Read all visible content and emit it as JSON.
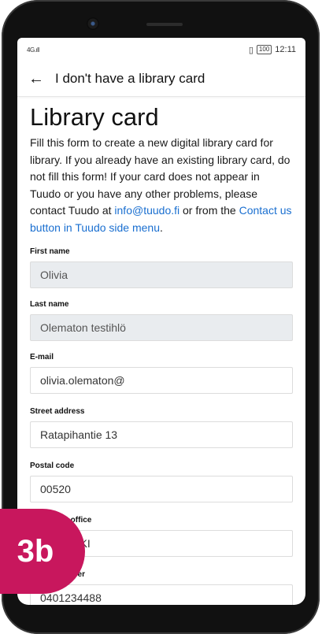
{
  "status": {
    "signal": "4G",
    "time": "12:11",
    "battery": "100"
  },
  "appbar": {
    "title": "I don't have a library card",
    "back_icon": "arrow-left-icon"
  },
  "page": {
    "title": "Library card",
    "intro_text": "Fill this form to create a new digital library card for library. If you already have an existing library card, do not fill this form! If your card does not appear in Tuudo or you have any other problems, please contact Tuudo at ",
    "email_link": "info@tuudo.fi",
    "intro_mid": " or from the ",
    "contact_link": "Contact us button in Tuudo side menu",
    "intro_end": "."
  },
  "form": {
    "first_name": {
      "label": "First name",
      "value": "Olivia"
    },
    "last_name": {
      "label": "Last name",
      "value": "Olematon testihlö"
    },
    "email": {
      "label": "E-mail",
      "value": "olivia.olematon@"
    },
    "street": {
      "label": "Street address",
      "value": "Ratapihantie 13"
    },
    "postal": {
      "label": "Postal code",
      "value": "00520"
    },
    "city": {
      "label": "City / Post office",
      "value": "HELSINKI"
    },
    "phone": {
      "label": "Phone number",
      "value": "0401234488"
    }
  },
  "badge": {
    "label": "3b",
    "color": "#c8175d"
  }
}
